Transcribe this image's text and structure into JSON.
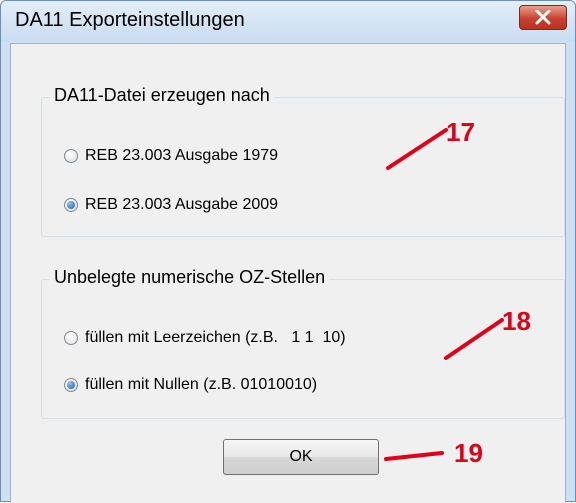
{
  "window": {
    "title": "DA11 Exporteinstellungen"
  },
  "group1": {
    "label": "DA11-Datei erzeugen nach",
    "options": [
      {
        "label": "REB 23.003 Ausgabe 1979",
        "selected": false
      },
      {
        "label": "REB 23.003 Ausgabe 2009",
        "selected": true
      }
    ]
  },
  "group2": {
    "label": "Unbelegte numerische OZ-Stellen",
    "options": [
      {
        "label": "füllen mit Leerzeichen (z.B.   1 1  10)",
        "selected": false
      },
      {
        "label": "füllen mit Nullen (z.B. 01010010)",
        "selected": true
      }
    ]
  },
  "buttons": {
    "ok_label": "OK"
  },
  "annotations": {
    "a17": "17",
    "a18": "18",
    "a19": "19"
  },
  "colors": {
    "annotation": "#e0001a",
    "close_button": "#c8422e",
    "dialog_background": "#f0f0f0",
    "frame": "#cfe0f3"
  }
}
